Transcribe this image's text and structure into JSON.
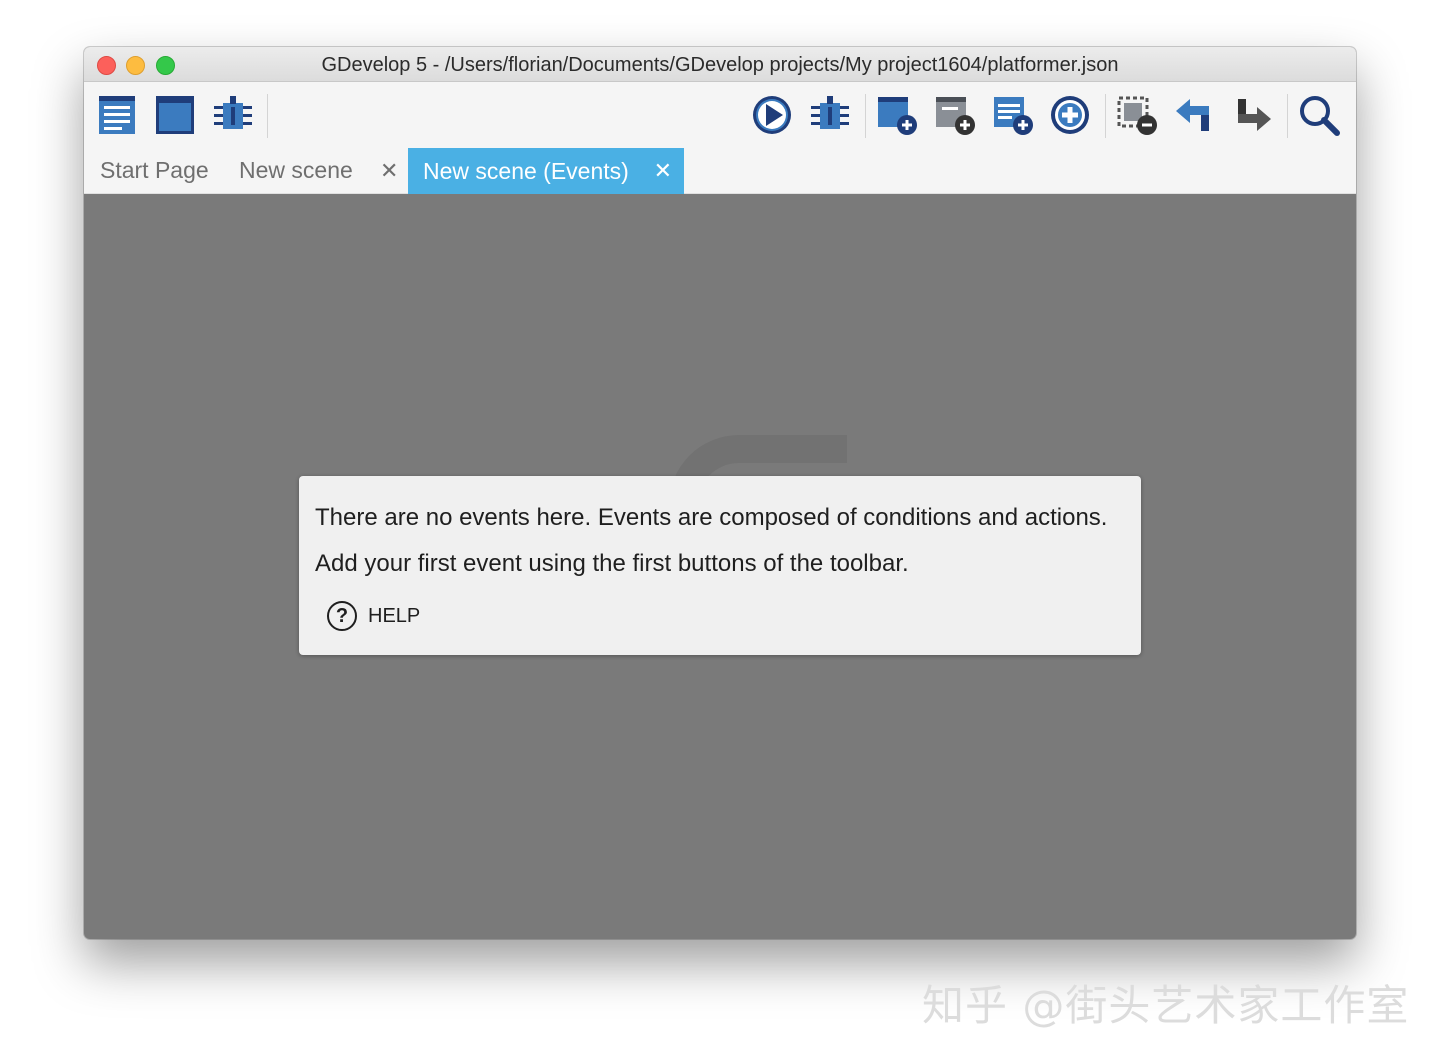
{
  "window": {
    "title": "GDevelop 5 - /Users/florian/Documents/GDevelop projects/My project1604/platformer.json"
  },
  "toolbar": {
    "left_icons": [
      "project-manager-icon",
      "scene-icon",
      "debugger-icon"
    ],
    "right_icons": [
      "preview-play-icon",
      "debug-preview-icon",
      "add-event-icon",
      "add-subevent-icon",
      "add-comment-icon",
      "add-instruction-icon",
      "delete-selected-icon",
      "undo-icon",
      "redo-icon",
      "search-icon"
    ]
  },
  "tabs": [
    {
      "label": "Start Page",
      "closable": false
    },
    {
      "label": "New scene",
      "closable": true,
      "close_glyph": "✕"
    },
    {
      "label": "New scene (Events)",
      "closable": true,
      "active": true,
      "close_glyph": "✕"
    }
  ],
  "empty_state": {
    "line1": "There are no events here. Events are composed of conditions and actions.",
    "line2": "Add your first event using the first buttons of the toolbar.",
    "help_label": "HELP",
    "help_icon": "?"
  },
  "watermark": "知乎 @街头艺术家工作室",
  "colors": {
    "accent_tab": "#4ab0e4",
    "icon_blue": "#3b7bbf",
    "icon_navy": "#1f3d7a",
    "canvas_bg": "#7a7a7a"
  }
}
